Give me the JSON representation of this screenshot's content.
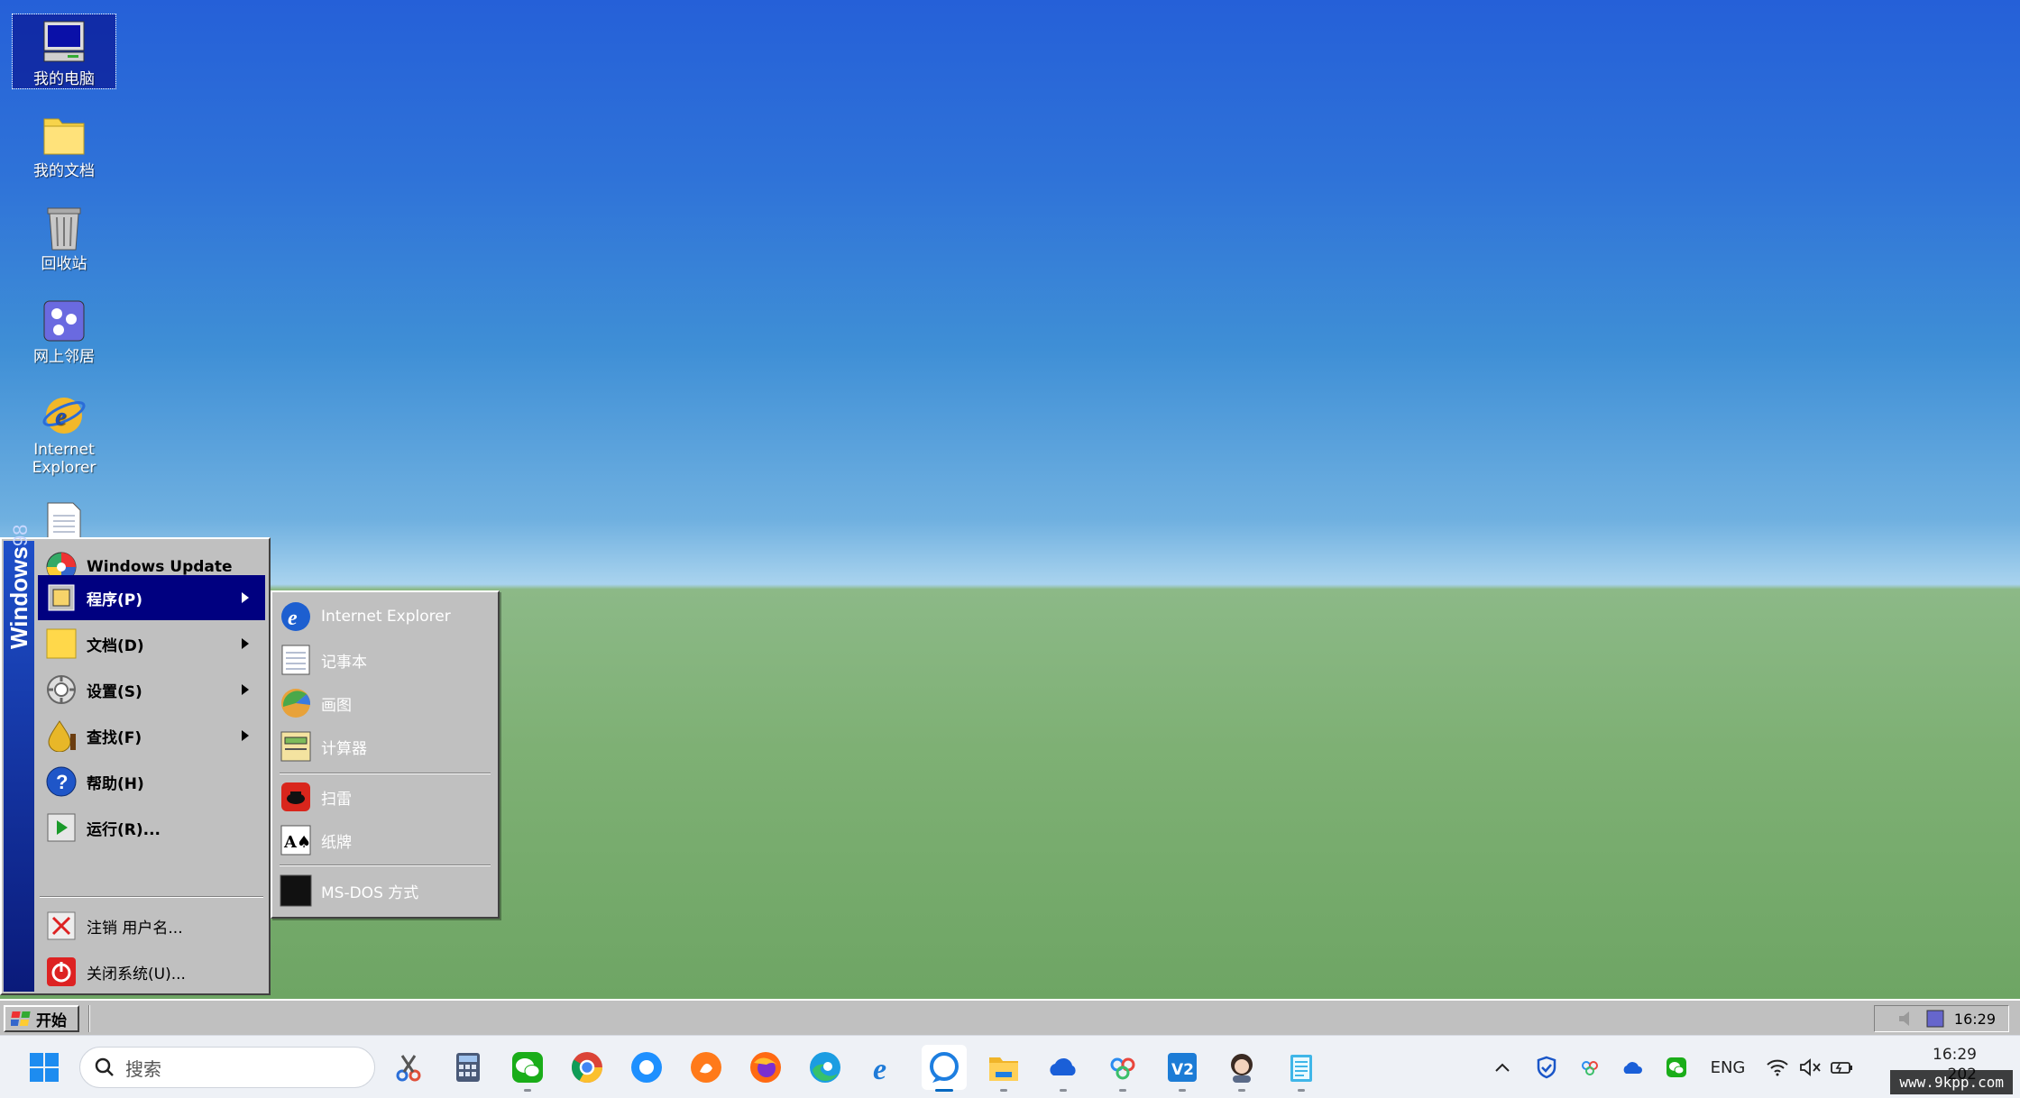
{
  "desktop": {
    "icons": [
      {
        "label": "我的电脑"
      },
      {
        "label": "我的文档"
      },
      {
        "label": "回收站"
      },
      {
        "label": "网上邻居"
      },
      {
        "label": "Internet Explorer"
      },
      {
        "label": ""
      }
    ]
  },
  "start_menu": {
    "strip_brand": "Windows",
    "strip_version": "98",
    "items": [
      {
        "label": "Windows Update"
      },
      {
        "label": "程序(P)"
      },
      {
        "label": "文档(D)"
      },
      {
        "label": "设置(S)"
      },
      {
        "label": "查找(F)"
      },
      {
        "label": "帮助(H)"
      },
      {
        "label": "运行(R)..."
      },
      {
        "label": "注销 用户名..."
      },
      {
        "label": "关闭系统(U)..."
      }
    ]
  },
  "programs_submenu": {
    "items": [
      {
        "label": "Internet Explorer"
      },
      {
        "label": "记事本"
      },
      {
        "label": "画图"
      },
      {
        "label": "计算器"
      },
      {
        "label": "扫雷"
      },
      {
        "label": "纸牌"
      },
      {
        "label": "MS-DOS 方式"
      }
    ]
  },
  "taskbar98": {
    "start_label": "开始",
    "clock": "16:29"
  },
  "taskbar11": {
    "search_placeholder": "搜索",
    "language": "ENG",
    "clock_time": "16:29",
    "clock_date": "202",
    "watermark": "www.9kpp.com"
  },
  "colors": {
    "menu_gray": "#c0c0c0",
    "highlight": "#000080",
    "strip_top": "#1e4fc9",
    "strip_bottom": "#0a1a7a",
    "win11_accent": "#0067c0"
  }
}
